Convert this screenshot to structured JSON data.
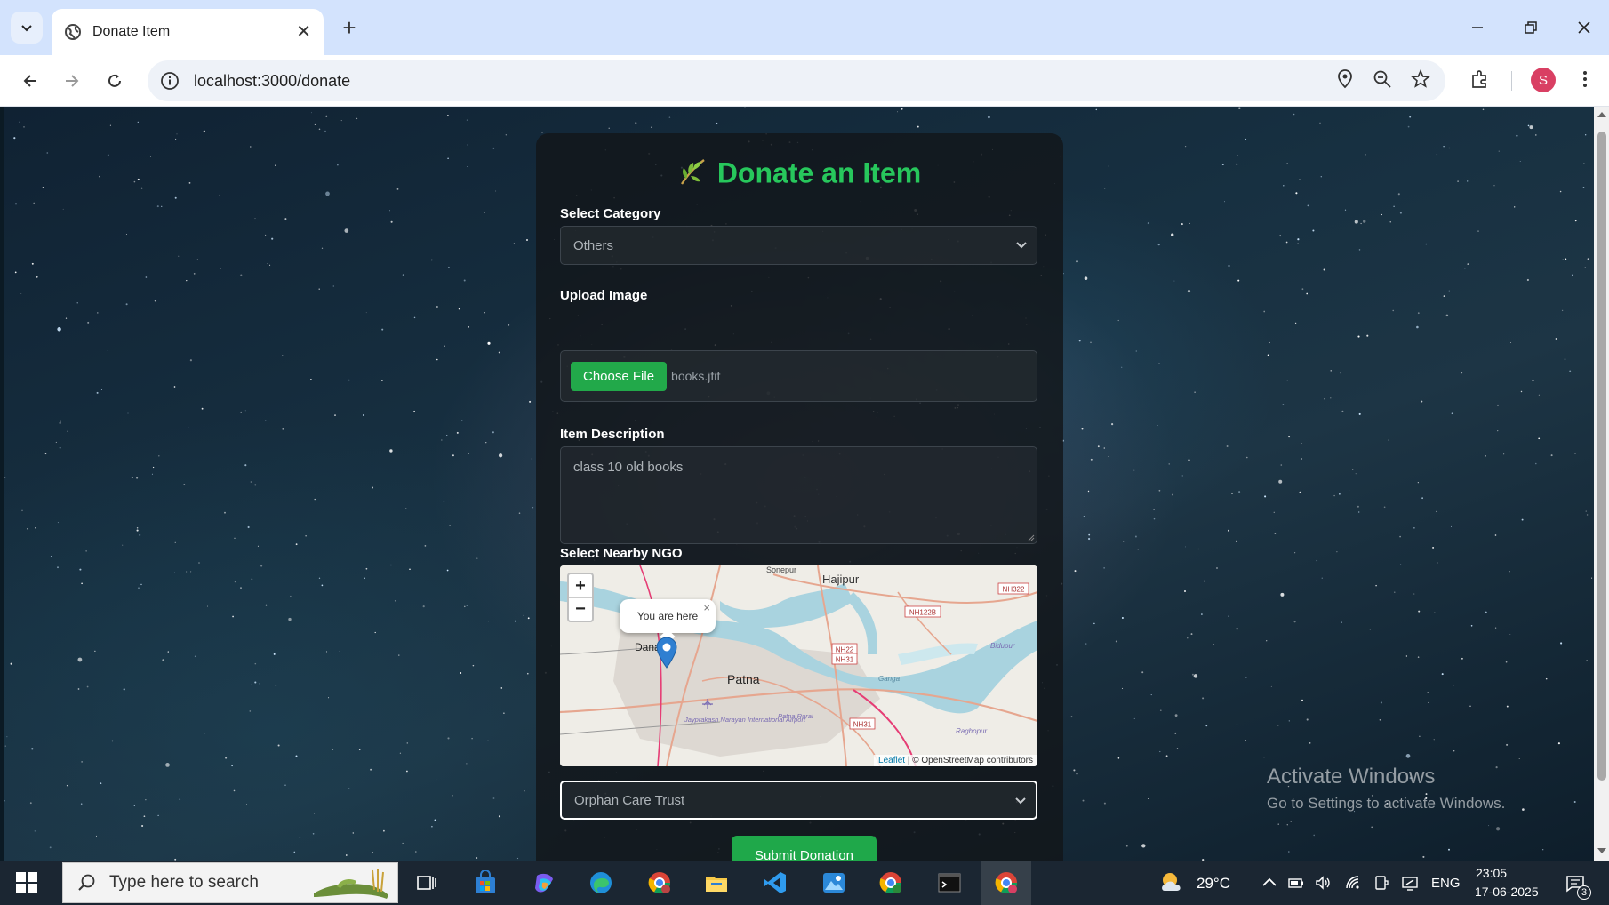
{
  "browser": {
    "tab_title": "Donate Item",
    "url": "localhost:3000/donate",
    "profile_initial": "S"
  },
  "form": {
    "title": "Donate an Item",
    "category_label": "Select Category",
    "category_value": "Others",
    "upload_label": "Upload Image",
    "choose_file_label": "Choose File",
    "file_name": "books.jfif",
    "description_label": "Item Description",
    "description_value": "class 10 old books",
    "ngo_label": "Select Nearby NGO",
    "ngo_value": "Orphan Care Trust",
    "submit_label": "Submit Donation",
    "accent_color": "#27c75c"
  },
  "map": {
    "zoom_in": "+",
    "zoom_out": "−",
    "popup_text": "You are here",
    "popup_close": "×",
    "place_labels": {
      "sonepur": "Sonepur",
      "hajipur": "Hajipur",
      "danapur": "Dana",
      "patna": "Patna",
      "airport": "Jayprakash Narayan International Airport",
      "patna_rural": "Patna Rural",
      "bidupur": "Bidupur",
      "raghopur": "Raghopur",
      "ganga": "Ganga"
    },
    "road_labels": {
      "nh322": "NH322",
      "nh122b": "NH122B",
      "nh22": "NH22",
      "nh31_a": "NH31",
      "nh31_b": "NH31"
    },
    "attribution_leaflet": "Leaflet",
    "attribution_rest": "| © OpenStreetMap contributors"
  },
  "watermark": {
    "line1": "Activate Windows",
    "line2": "Go to Settings to activate Windows."
  },
  "taskbar": {
    "search_placeholder": "Type here to search",
    "weather": "29°C",
    "language": "ENG",
    "time": "23:05",
    "date": "17-06-2025",
    "notification_count": "3"
  }
}
